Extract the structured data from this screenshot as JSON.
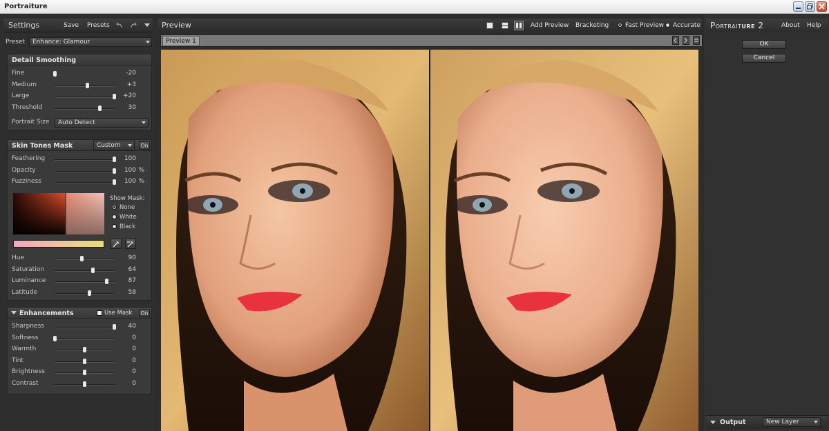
{
  "window": {
    "title": "Portraiture"
  },
  "settings": {
    "title": "Settings",
    "save_label": "Save",
    "presets_label": "Presets",
    "preset_label": "Preset",
    "preset_value": "Enhance: Glamour"
  },
  "detail_smoothing": {
    "title": "Detail Smoothing",
    "sliders": [
      {
        "label": "Fine",
        "value": "-20",
        "pos": 0.0
      },
      {
        "label": "Medium",
        "value": "+3",
        "pos": 0.55
      },
      {
        "label": "Large",
        "value": "+20",
        "pos": 1.0
      },
      {
        "label": "Threshold",
        "value": "30",
        "pos": 0.75
      }
    ],
    "portrait_size_label": "Portrait Size",
    "portrait_size_value": "Auto Detect"
  },
  "skin_tones_mask": {
    "title": "Skin Tones Mask",
    "mode_value": "Custom",
    "on_label": "On",
    "sliders": [
      {
        "label": "Feathering",
        "value": "100",
        "unit": "",
        "pos": 1.0
      },
      {
        "label": "Opacity",
        "value": "100",
        "unit": "%",
        "pos": 1.0
      },
      {
        "label": "Fuzziness",
        "value": "100",
        "unit": "%",
        "pos": 1.0
      }
    ],
    "show_mask_label": "Show Mask:",
    "show_mask_options": [
      "None",
      "White",
      "Black"
    ],
    "color_sliders": [
      {
        "label": "Hue",
        "value": "90",
        "pos": 0.45
      },
      {
        "label": "Saturation",
        "value": "64",
        "pos": 0.64
      },
      {
        "label": "Luminance",
        "value": "87",
        "pos": 0.87
      },
      {
        "label": "Latitude",
        "value": "58",
        "pos": 0.58
      }
    ]
  },
  "enhancements": {
    "title": "Enhancements",
    "use_mask_label": "Use Mask",
    "on_label": "On",
    "sliders": [
      {
        "label": "Sharpness",
        "value": "40",
        "pos": 1.0
      },
      {
        "label": "Softness",
        "value": "0",
        "pos": 0.0
      },
      {
        "label": "Warmth",
        "value": "0",
        "pos": 0.5
      },
      {
        "label": "Tint",
        "value": "0",
        "pos": 0.5
      },
      {
        "label": "Brightness",
        "value": "0",
        "pos": 0.5
      },
      {
        "label": "Contrast",
        "value": "0",
        "pos": 0.5
      }
    ]
  },
  "preview": {
    "title": "Preview",
    "add_preview_label": "Add Preview",
    "bracketing_label": "Bracketing",
    "fast_preview_label": "Fast Preview",
    "accurate_label": "Accurate",
    "tab_label": "Preview 1"
  },
  "right_panel": {
    "brand_prefix": "Portrait",
    "brand_suffix": "ure",
    "brand_version": "2",
    "about_label": "About",
    "help_label": "Help",
    "ok_label": "OK",
    "cancel_label": "Cancel",
    "output_label": "Output",
    "output_value": "New Layer"
  },
  "colors": {
    "accent_gradient_start": "#f2a6c0",
    "accent_gradient_end": "#e8e07a",
    "lipstick": "#e8333f"
  }
}
